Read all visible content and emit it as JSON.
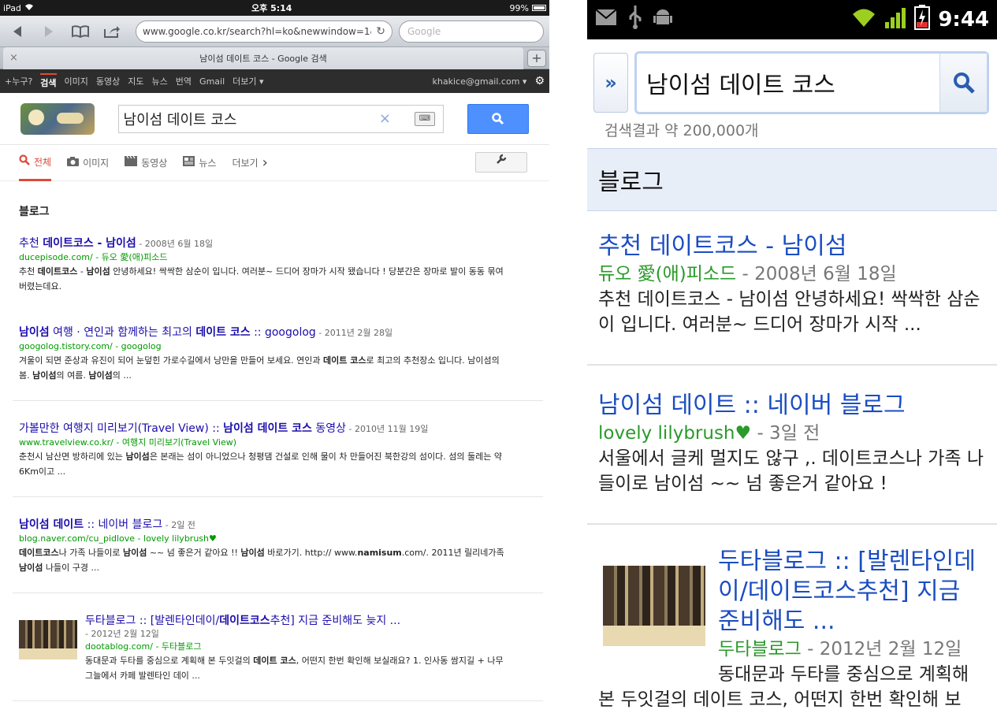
{
  "ipad": {
    "status": {
      "device": "iPad",
      "wifi": "wifi-icon",
      "time": "오후 5:14",
      "battery": "99%"
    },
    "toolbar": {
      "url": "www.google.co.kr/search?hl=ko&newwindow=1&",
      "search_placeholder": "Google"
    },
    "tab": {
      "title": "남이섬 데이트 코스 - Google 검색",
      "close": "×",
      "new": "+"
    },
    "gbar": {
      "items": [
        "+누구?",
        "검색",
        "이미지",
        "동영상",
        "지도",
        "뉴스",
        "번역",
        "Gmail",
        "더보기 ▾"
      ],
      "email": "khakice@gmail.com ▾"
    },
    "search": {
      "query": "남이섬 데이트 코스",
      "clear": "×"
    },
    "nav": {
      "items": [
        {
          "icon": "🔍",
          "label": "전체"
        },
        {
          "icon": "📷",
          "label": "이미지"
        },
        {
          "icon": "🎬",
          "label": "동영상"
        },
        {
          "icon": "📰",
          "label": "뉴스"
        },
        {
          "icon": "",
          "label": "더보기"
        }
      ],
      "more_arrow": "›"
    },
    "section": "블로그",
    "results": [
      {
        "title_a": "추천 ",
        "title_b": "데이트코스 - 남이섬",
        "date": " - 2008년 6월 18일",
        "cite": "ducepisode.com/ - 듀오 愛(애)피소드",
        "snip_a": "추천 ",
        "snip_b": "데이트코스",
        "snip_c": " - ",
        "snip_d": "남이섬",
        "snip_e": " 안녕하세요! 싹싹한 삼순이 입니다. 여러분~ 드디어 장마가 시작 됐습니다 ! 당분간은 장마로 발이 동동 묶여 버렸는데요."
      },
      {
        "title_a": "남이섬",
        "title_b": " 여행 · 연인과 함께하는 최고의 ",
        "title_c": "데이트 코스",
        "title_d": " :: googolog",
        "date": " - 2011년 2월 28일",
        "cite": "googolog.tistory.com/ - googolog",
        "snip_a": "겨울이 되면 준상과 유진이 되어 눈덮힌 가로수길에서 낭만을 만들어 보세요. 연인과 ",
        "snip_b": "데이트 코스",
        "snip_c": "로 최고의 추천장소 입니다. 남이섬의 봄. ",
        "snip_d": "남이섬",
        "snip_e": "의 여름. ",
        "snip_f": "남이섬",
        "snip_g": "의 ..."
      },
      {
        "title_a": "가볼만한 여행지 미리보기(Travel View) :: ",
        "title_b": "남이섬 데이트 코스",
        "title_c": " 동영상",
        "date": " - 2010년 11월 19일",
        "cite": "www.travelview.co.kr/ - 여행지 미리보기(Travel View)",
        "snip_a": "춘천시 남산면 방하리에 있는 ",
        "snip_b": "남이섬",
        "snip_c": "은 본래는 섬이 아니었으나 청평댐 건설로 인해 물이 차 만들어진 북한강의 섬이다. 섬의 둘레는 약 6Km이고 ..."
      },
      {
        "title_a": "남이섬 데이트",
        "title_b": " :: 네이버 블로그",
        "date": " - 2일 전",
        "cite": "blog.naver.com/cu_pidlove - lovely lilybrush♥",
        "snip_a": "데이트코스",
        "snip_b": "나 가족 나들이로 ",
        "snip_c": "남이섬",
        "snip_d": " ~~ 넘 좋은거 같아요 !! ",
        "snip_e": "남이섬",
        "snip_f": " 바로가기. http:// www.",
        "snip_g": "namisum",
        "snip_h": ".com/. 2011년 릴리네가족 ",
        "snip_i": "남이섬",
        "snip_j": " 나들이 구경 ..."
      },
      {
        "title_a": "두타블로그 :: [발렌타인데이/",
        "title_b": "데이트코스",
        "title_c": "추천] 지금 준비해도 늦지 ...",
        "date": "- 2012년 2월 12일",
        "cite": "dootablog.com/ - 두타블로그",
        "snip_a": "동대문과 두타를 중심으로 계획해 본 두잇걸의 ",
        "snip_b": "데이트 코스",
        "snip_c": ", 어떤지 한번 확인해 보실래요? 1. 인사동 쌈지길 + 나무그늘에서 카페 발렌타인 데이 ..."
      }
    ]
  },
  "android": {
    "status": {
      "time": "9:44"
    },
    "search": {
      "query": "남이섬 데이트 코스",
      "chevron": "»"
    },
    "count": "검색결과 약 200,000개",
    "section": "블로그",
    "results": [
      {
        "title": "추천 데이트코스 - 남이섬",
        "cite": "듀오 愛(애)피소드",
        "date": " - 2008년 6월 18일",
        "snip": "추천 데이트코스 - 남이섬 안녕하세요! 싹싹한 삼순이 입니다. 여러분~ 드디어 장마가 시작 ..."
      },
      {
        "title": "남이섬 데이트 :: 네이버 블로그",
        "cite": "lovely lilybrush♥",
        "date": " - 3일 전",
        "snip": "서울에서 글케 멀지도 않구 ,. 데이트코스나 가족 나들이로 남이섬 ~~ 넘 좋은거 같아요 !"
      },
      {
        "title": "두타블로그 :: [발렌타인데이/데이트코스추천] 지금 준비해도 ...",
        "cite": "두타블로그",
        "date": " - 2012년 2월 12일",
        "snip_a": "동대문과 두타를 중심으로 계획해",
        "snip_b": "본 두잇걸의 데이트 코스, 어떤지 한번 확인해 보"
      }
    ]
  }
}
